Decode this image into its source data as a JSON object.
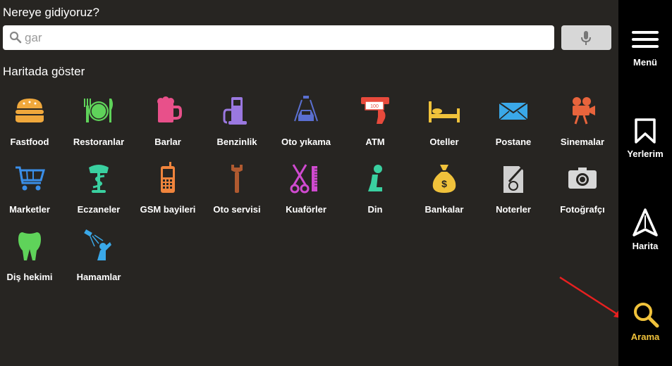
{
  "prompt": "Nereye gidiyoruz?",
  "search": {
    "placeholder": "gar",
    "value": ""
  },
  "section_title": "Haritada göster",
  "categories": [
    {
      "label": "Fastfood",
      "icon": "burger-icon",
      "color": "#f0a83c"
    },
    {
      "label": "Restoranlar",
      "icon": "plate-cutlery-icon",
      "color": "#5fd35a"
    },
    {
      "label": "Barlar",
      "icon": "beer-mug-icon",
      "color": "#e8508a"
    },
    {
      "label": "Benzinlik",
      "icon": "fuel-pump-icon",
      "color": "#9a78e0"
    },
    {
      "label": "Oto yıkama",
      "icon": "car-wash-icon",
      "color": "#5a6fd0"
    },
    {
      "label": "ATM",
      "icon": "atm-icon",
      "color": "#e84a3c"
    },
    {
      "label": "Oteller",
      "icon": "bed-icon",
      "color": "#f0c23b"
    },
    {
      "label": "Postane",
      "icon": "envelope-icon",
      "color": "#3aa8e8"
    },
    {
      "label": "Sinemalar",
      "icon": "film-camera-icon",
      "color": "#e8643c"
    },
    {
      "label": "Marketler",
      "icon": "shopping-cart-icon",
      "color": "#3a8ee8"
    },
    {
      "label": "Eczaneler",
      "icon": "pharmacy-icon",
      "color": "#3ad0a0"
    },
    {
      "label": "GSM bayileri",
      "icon": "mobile-phone-icon",
      "color": "#f0843c"
    },
    {
      "label": "Oto servisi",
      "icon": "wrench-icon",
      "color": "#b05a30"
    },
    {
      "label": "Kuaförler",
      "icon": "scissors-comb-icon",
      "color": "#d04ad0"
    },
    {
      "label": "Din",
      "icon": "praying-person-icon",
      "color": "#3ad0a0"
    },
    {
      "label": "Bankalar",
      "icon": "money-bag-icon",
      "color": "#f0c23b"
    },
    {
      "label": "Noterler",
      "icon": "notary-document-icon",
      "color": "#d0d0d0"
    },
    {
      "label": "Fotoğrafçı",
      "icon": "photo-camera-icon",
      "color": "#d8d8d8"
    },
    {
      "label": "Diş hekimi",
      "icon": "tooth-icon",
      "color": "#5fd35a"
    },
    {
      "label": "Hamamlar",
      "icon": "shower-icon",
      "color": "#3aa8e8"
    }
  ],
  "sidebar": {
    "items": [
      {
        "label": "Menü",
        "icon": "hamburger-menu-icon"
      },
      {
        "label": "Yerlerim",
        "icon": "bookmark-icon"
      },
      {
        "label": "Harita",
        "icon": "navigation-arrow-icon"
      },
      {
        "label": "Arama",
        "icon": "search-icon",
        "active": true
      }
    ]
  },
  "colors": {
    "background": "#272522",
    "sidebar": "#000000",
    "accent": "#f0c23b"
  }
}
